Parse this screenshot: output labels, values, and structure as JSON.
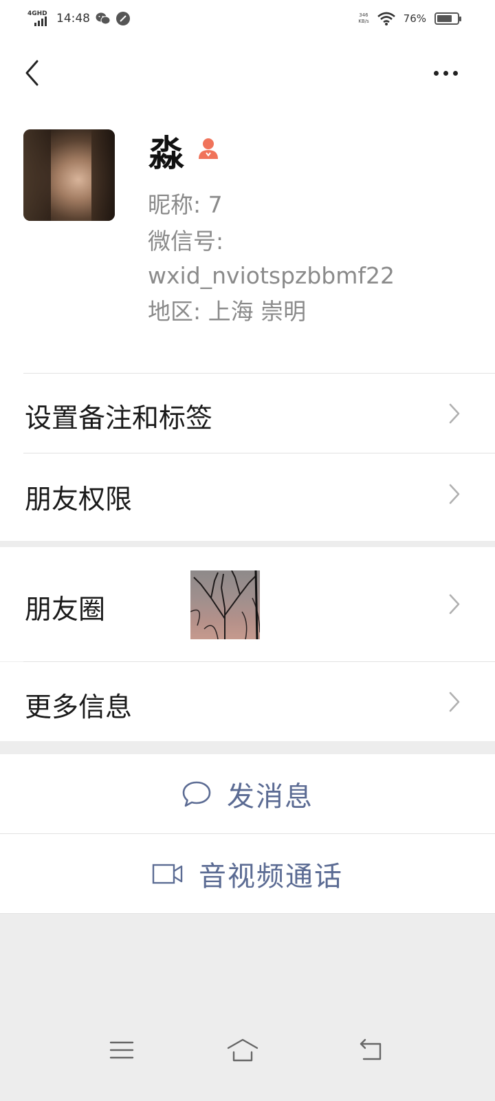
{
  "status_bar": {
    "network": "4GHD",
    "time": "14:48",
    "net_speed_value": "346",
    "net_speed_unit": "KB/s",
    "battery_percent": "76%",
    "battery_level": 0.76,
    "icons": [
      "signal-icon",
      "wechat-icon",
      "notification-icon",
      "wifi-icon",
      "battery-icon"
    ]
  },
  "header": {
    "back_icon": "chevron-left-icon",
    "more_icon": "more-dots-icon"
  },
  "profile": {
    "name": "淼",
    "gender_icon": "female-icon",
    "gender_color": "#f0735a",
    "nickname": "昵称: 7",
    "wechat_id_label": "微信号:",
    "wechat_id": "wxid_nviotspzbbmf22",
    "region": "地区: 上海 崇明"
  },
  "rows": {
    "remarks_tags": "设置备注和标签",
    "friend_permissions": "朋友权限",
    "moments": "朋友圈",
    "more_info": "更多信息"
  },
  "actions": {
    "send_message": "发消息",
    "video_call": "音视频通话",
    "accent_color": "#5b6b93"
  },
  "nav_bar": {
    "icons": [
      "menu-icon",
      "home-icon",
      "back-icon"
    ]
  }
}
